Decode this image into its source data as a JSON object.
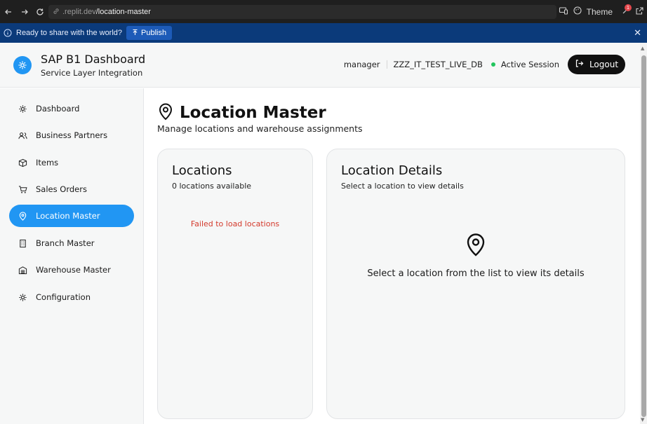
{
  "browser": {
    "url_host": ".replit.dev",
    "url_path": "/location-master",
    "theme_label": "Theme",
    "notification_count": "1"
  },
  "share_bar": {
    "text": "Ready to share with the world?",
    "publish_label": "Publish"
  },
  "header": {
    "title": "SAP B1 Dashboard",
    "subtitle": "Service Layer Integration",
    "user": "manager",
    "database": "ZZZ_IT_TEST_LIVE_DB",
    "session_status": "Active Session",
    "logout_label": "Logout"
  },
  "sidebar": {
    "items": [
      {
        "label": "Dashboard",
        "icon": "gear-icon"
      },
      {
        "label": "Business Partners",
        "icon": "users-icon"
      },
      {
        "label": "Items",
        "icon": "box-icon"
      },
      {
        "label": "Sales Orders",
        "icon": "cart-icon"
      },
      {
        "label": "Location Master",
        "icon": "map-pin-icon",
        "active": true
      },
      {
        "label": "Branch Master",
        "icon": "building-icon"
      },
      {
        "label": "Warehouse Master",
        "icon": "warehouse-icon"
      },
      {
        "label": "Configuration",
        "icon": "gear-icon"
      }
    ]
  },
  "main": {
    "title": "Location Master",
    "subtitle": "Manage locations and warehouse assignments",
    "locations_card": {
      "title": "Locations",
      "count_text": "0 locations available",
      "error_text": "Failed to load locations"
    },
    "details_card": {
      "title": "Location Details",
      "description": "Select a location to view details",
      "empty_text": "Select a location from the list to view its details"
    }
  },
  "colors": {
    "accent": "#2196f3",
    "error": "#d33a2c",
    "status_active": "#22c55e",
    "banner": "#0b3a7a"
  }
}
